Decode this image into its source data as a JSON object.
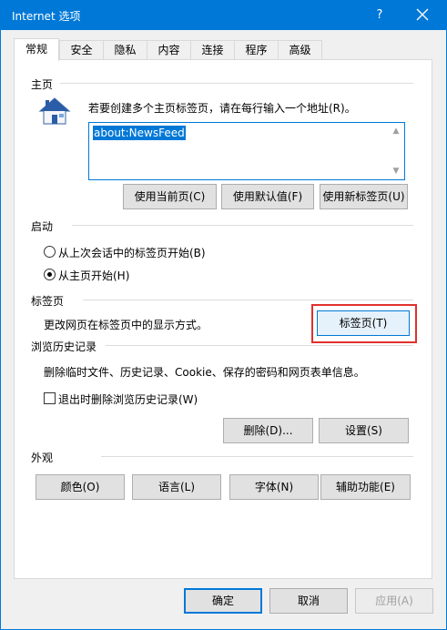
{
  "window": {
    "title": "Internet 选项",
    "help_label": "?"
  },
  "tabs": [
    {
      "label": "常规",
      "active": true
    },
    {
      "label": "安全"
    },
    {
      "label": "隐私"
    },
    {
      "label": "内容"
    },
    {
      "label": "连接"
    },
    {
      "label": "程序"
    },
    {
      "label": "高级"
    }
  ],
  "homepage": {
    "group_label": "主页",
    "description": "若要创建多个主页标签页，请在每行输入一个地址(R)。",
    "value": "about:NewsFeed",
    "buttons": {
      "use_current": "使用当前页(C)",
      "use_default": "使用默认值(F)",
      "use_new_tab": "使用新标签页(U)"
    }
  },
  "startup": {
    "group_label": "启动",
    "option_last_session": "从上次会话中的标签页开始(B)",
    "option_homepage": "从主页开始(H)",
    "selected": "option_homepage"
  },
  "tabs_section": {
    "group_label": "标签页",
    "description": "更改网页在标签页中的显示方式。",
    "button": "标签页(T)"
  },
  "history": {
    "group_label": "浏览历史记录",
    "description": "删除临时文件、历史记录、Cookie、保存的密码和网页表单信息。",
    "checkbox_label": "退出时删除浏览历史记录(W)",
    "checkbox_checked": false,
    "delete_button": "删除(D)...",
    "settings_button": "设置(S)"
  },
  "appearance": {
    "group_label": "外观",
    "colors_button": "颜色(O)",
    "languages_button": "语言(L)",
    "fonts_button": "字体(N)",
    "accessibility_button": "辅助功能(E)"
  },
  "footer": {
    "ok_button": "确定",
    "cancel_button": "取消",
    "apply_button": "应用(A)"
  },
  "colors": {
    "accent": "#0078d7",
    "highlight": "#e0312c"
  }
}
